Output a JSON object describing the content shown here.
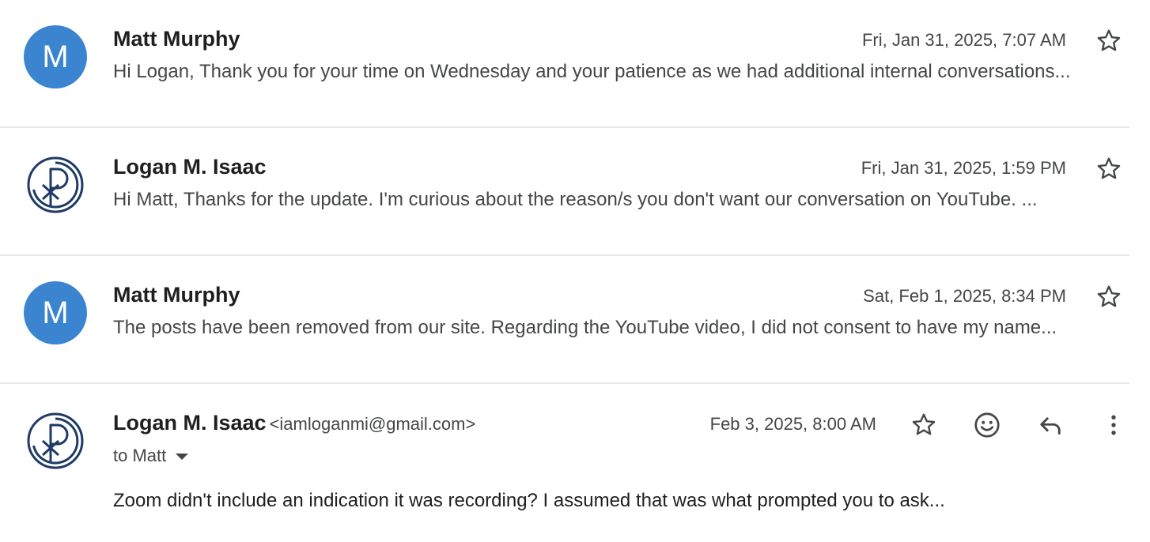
{
  "messages": [
    {
      "avatar_letter": "M",
      "sender": "Matt Murphy",
      "date": "Fri, Jan 31, 2025, 7:07 AM",
      "snippet": "Hi Logan, Thank you for your time on Wednesday and your patience as we had additional internal conversations..."
    },
    {
      "avatar_letter": "",
      "sender": "Logan M. Isaac",
      "date": "Fri, Jan 31, 2025, 1:59 PM",
      "snippet": "Hi Matt, Thanks for the update. I'm curious about the reason/s you don't want our conversation on YouTube. ..."
    },
    {
      "avatar_letter": "M",
      "sender": "Matt Murphy",
      "date": "Sat, Feb 1, 2025, 8:34 PM",
      "snippet": "The posts have been removed from our site. Regarding the YouTube video, I did not consent to have my name..."
    }
  ],
  "expanded": {
    "sender": "Logan M. Isaac",
    "email": "<iamloganmi@gmail.com>",
    "date": "Feb 3, 2025, 8:00 AM",
    "to": "to Matt",
    "body": "Zoom didn't include an indication it was recording? I assumed that was what prompted you to ask..."
  },
  "colors": {
    "avatar_blue": "#3a84d0",
    "logo_navy": "#1f3a66"
  }
}
